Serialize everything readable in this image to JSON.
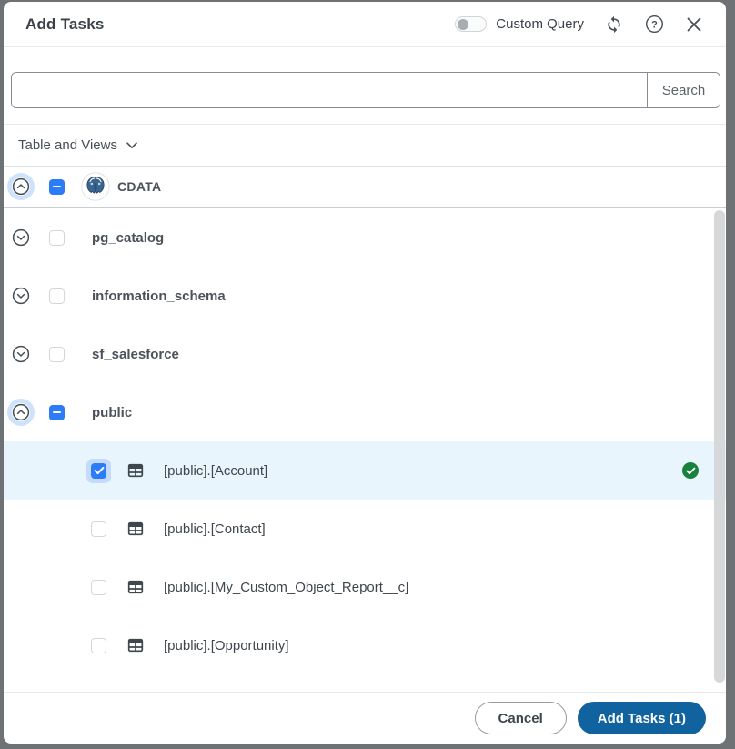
{
  "header": {
    "title": "Add Tasks",
    "toggle_label": "Custom Query",
    "toggle_state": "off",
    "icons": [
      "refresh-icon",
      "help-icon",
      "close-icon"
    ]
  },
  "search": {
    "value": "",
    "button_label": "Search"
  },
  "filter": {
    "label": "Table and Views",
    "icon": "chevron-down-icon"
  },
  "tree": {
    "connection": {
      "label": "CDATA",
      "icon": "postgresql-logo",
      "expanded": true,
      "checkbox": "indeterminate"
    },
    "schemas": [
      {
        "label": "pg_catalog",
        "expanded": false,
        "checkbox": "unchecked"
      },
      {
        "label": "information_schema",
        "expanded": false,
        "checkbox": "unchecked"
      },
      {
        "label": "sf_salesforce",
        "expanded": false,
        "checkbox": "unchecked"
      },
      {
        "label": "public",
        "expanded": true,
        "checkbox": "indeterminate"
      }
    ],
    "tables": [
      {
        "label": "[public].[Account]",
        "checkbox": "checked",
        "selected": true,
        "status_icon": "check-circle-green"
      },
      {
        "label": "[public].[Contact]",
        "checkbox": "unchecked",
        "selected": false
      },
      {
        "label": "[public].[My_Custom_Object_Report__c]",
        "checkbox": "unchecked",
        "selected": false
      },
      {
        "label": "[public].[Opportunity]",
        "checkbox": "unchecked",
        "selected": false
      }
    ]
  },
  "footer": {
    "cancel_label": "Cancel",
    "submit_label": "Add Tasks (1)",
    "selected_count": "1"
  },
  "colors": {
    "accent_blue": "#2c7cf8",
    "primary_button": "#11639f",
    "row_highlight": "#e9f5fc",
    "status_green": "#17813d",
    "backdrop": "#6f7274"
  }
}
